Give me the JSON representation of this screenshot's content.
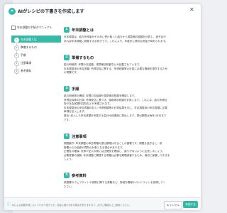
{
  "header": {
    "title": "AIがレシピの下書きを作成します",
    "close_symbol": "✕"
  },
  "nav": {
    "heading": "年末調整の手続きマニュアル",
    "items": [
      {
        "num": "1",
        "label": "年末調整とは",
        "active": true
      },
      {
        "num": "2",
        "label": "準備するもの",
        "active": false
      },
      {
        "num": "3",
        "label": "手順",
        "active": false
      },
      {
        "num": "4",
        "label": "注意事項",
        "active": false
      },
      {
        "num": "5",
        "label": "参考資料",
        "active": false
      }
    ]
  },
  "sections": [
    {
      "num": "1",
      "title": "年末調整とは",
      "lines": [
        "年末調整は、給与所得者がその年に受け取った給与から源泉徴収税額を計算し、過不足が",
        "あれば年末調整に調整する手続きです。これにより、年度末に適切な税金が納められます。"
      ]
    },
    {
      "num": "2",
      "title": "準備するもの",
      "lines": [
        "給与明細書: 年間の支給額、源泉徴収税額などが記載されています。",
        "年末調整用の申告書類: 所得控除に関する、所得税額等の計算に必要な情報を提供するため",
        "の書類です。"
      ]
    },
    {
      "num": "3",
      "title": "手順",
      "lines": [
        "給与明細書の確認: 年間の支給額や源泉徴収税額を確認します。",
        "所得控除等の計算: 所得税法に基づき、源泉徴収税額を計算します。これには、給与所得控",
        "除や社会保険料控除などが考慮されます。",
        "年末調整用の申告書類の記入: 所得税額等の計算結果を元に、年末調整用の申告書類に必要",
        "事項を記入します。",
        "提出: 記入した申告書類を所属する会社や経理部に提出します。提出期限は毎年1月末まで",
        "です。"
      ]
    },
    {
      "num": "4",
      "title": "注意事項",
      "lines": [
        "期限厳守: 年末調整の申告書類の提出期限は守ることが重要です。期限を過ぎると、税",
        "務署からの指導や罰則の対象となる場合があります。",
        "正確性の確保: 計算や記入の際には正確性を確保し、誤りがないように注意しましょう。",
        "必要書類の保管: 年末調整に関連する書類は必要な期間保管するため、適切に保管しておきま",
        "しょう。"
      ]
    },
    {
      "num": "5",
      "title": "参考資料",
      "lines": [
        "税務署のウェブサイトや税務に関する書籍など、詳細な情報やガイドラインを参照してく",
        "ださい。"
      ]
    }
  ],
  "footer": {
    "note": "AIによる自動作成したレシピの下書きです。内容に誤りがある場合がありますので、必ずご確認の上ご使用ください。",
    "cancel_label": "キャンセル",
    "create_label": "作成する"
  },
  "colors": {
    "accent": "#39b8a8"
  }
}
